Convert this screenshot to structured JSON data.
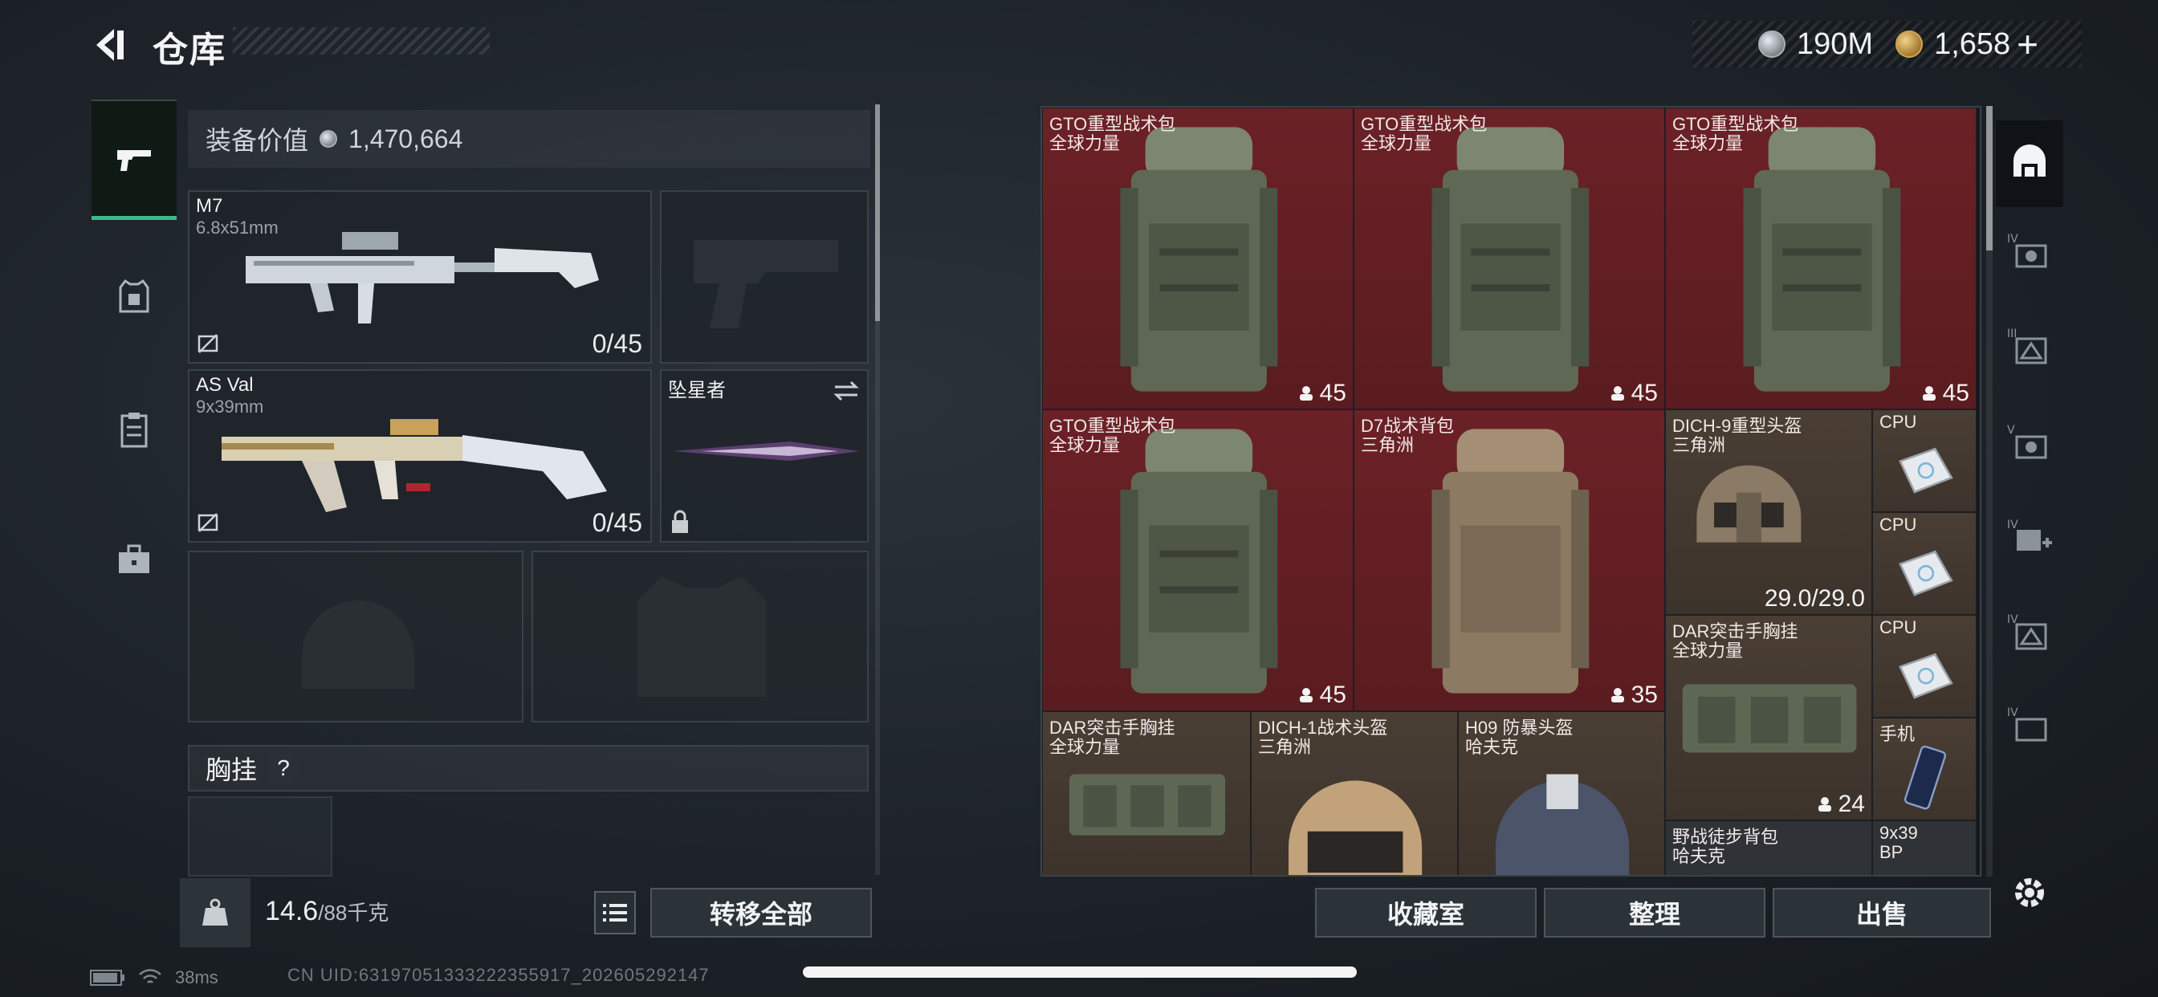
{
  "header": {
    "title": "仓库",
    "currency_silver": "190M",
    "currency_gold": "1,658",
    "add_label": "+"
  },
  "left_tabs": [
    {
      "name": "weapons",
      "icon": "pistol-icon",
      "active": true
    },
    {
      "name": "armor",
      "icon": "vest-icon",
      "active": false
    },
    {
      "name": "clipboard",
      "icon": "clipboard-icon",
      "active": false
    },
    {
      "name": "briefcase",
      "icon": "briefcase-icon",
      "active": false
    }
  ],
  "loadout": {
    "equip_value_label": "装备价值",
    "equip_value": "1,470,664",
    "primary": {
      "name": "M7",
      "caliber": "6.8x51mm",
      "ammo": "0/45"
    },
    "secondary": {
      "name": "AS Val",
      "caliber": "9x39mm",
      "ammo": "0/45"
    },
    "melee": {
      "name": "坠星者"
    },
    "rig_label": "胸挂",
    "rig_help": "?",
    "weight": "14.6",
    "weight_max": "/88千克",
    "transfer_all": "转移全部"
  },
  "stash": {
    "items": [
      {
        "l1": "GTO重型战术包",
        "l2": "全球力量",
        "count": "45",
        "kind": "backpack-green"
      },
      {
        "l1": "GTO重型战术包",
        "l2": "全球力量",
        "count": "45",
        "kind": "backpack-green"
      },
      {
        "l1": "GTO重型战术包",
        "l2": "全球力量",
        "count": "45",
        "kind": "backpack-green"
      },
      {
        "l1": "GTO重型战术包",
        "l2": "全球力量",
        "count": "45",
        "kind": "backpack-green"
      },
      {
        "l1": "D7战术背包",
        "l2": "三角洲",
        "count": "35",
        "kind": "backpack-tan"
      },
      {
        "l1": "DICH-9重型头盔",
        "l2": "三角洲",
        "count": "29.0/29.0",
        "kind": "helmet"
      },
      {
        "l1": "CPU",
        "kind": "cpu"
      },
      {
        "l1": "CPU",
        "kind": "cpu"
      },
      {
        "l1": "DAR突击手胸挂",
        "l2": "全球力量",
        "count": "24",
        "kind": "rig"
      },
      {
        "l1": "CPU",
        "kind": "cpu"
      },
      {
        "l1": "手机",
        "kind": "phone"
      },
      {
        "l1": "DAR突击手胸挂",
        "l2": "全球力量",
        "kind": "rig"
      },
      {
        "l1": "DICH-1战术头盔",
        "l2": "三角洲",
        "kind": "helmet-tan"
      },
      {
        "l1": "H09 防暴头盔",
        "l2": "哈夫克",
        "kind": "helmet-blue"
      },
      {
        "l1": "野战徒步背包",
        "l2": "哈夫克",
        "kind": "backpack"
      },
      {
        "l1": "9x39",
        "l2": "BP",
        "kind": "ammo"
      }
    ]
  },
  "buttons": {
    "collection": "收藏室",
    "sort": "整理",
    "sell": "出售"
  },
  "right_tabs": [
    {
      "name": "all",
      "icon": "all-items-icon",
      "active": true
    },
    {
      "name": "cat-iv-1",
      "icon": "iv-gear-icon",
      "active": false
    },
    {
      "name": "cat-iii",
      "icon": "iii-gear-icon",
      "active": false
    },
    {
      "name": "cat-v",
      "icon": "v-gear-icon",
      "active": false
    },
    {
      "name": "cat-iv-plus",
      "icon": "iv-plus-icon",
      "active": false
    },
    {
      "name": "cat-iv-2",
      "icon": "iv-box-icon",
      "active": false
    },
    {
      "name": "cat-iv-3",
      "icon": "iv-stack-icon",
      "active": false
    }
  ],
  "status": {
    "ping": "38ms",
    "uid": "CN UID:63197051333222355917_202605292147"
  },
  "colors": {
    "accent": "#3db98a",
    "stash_red": "#6b2126",
    "stash_brown": "#4a3e34"
  }
}
